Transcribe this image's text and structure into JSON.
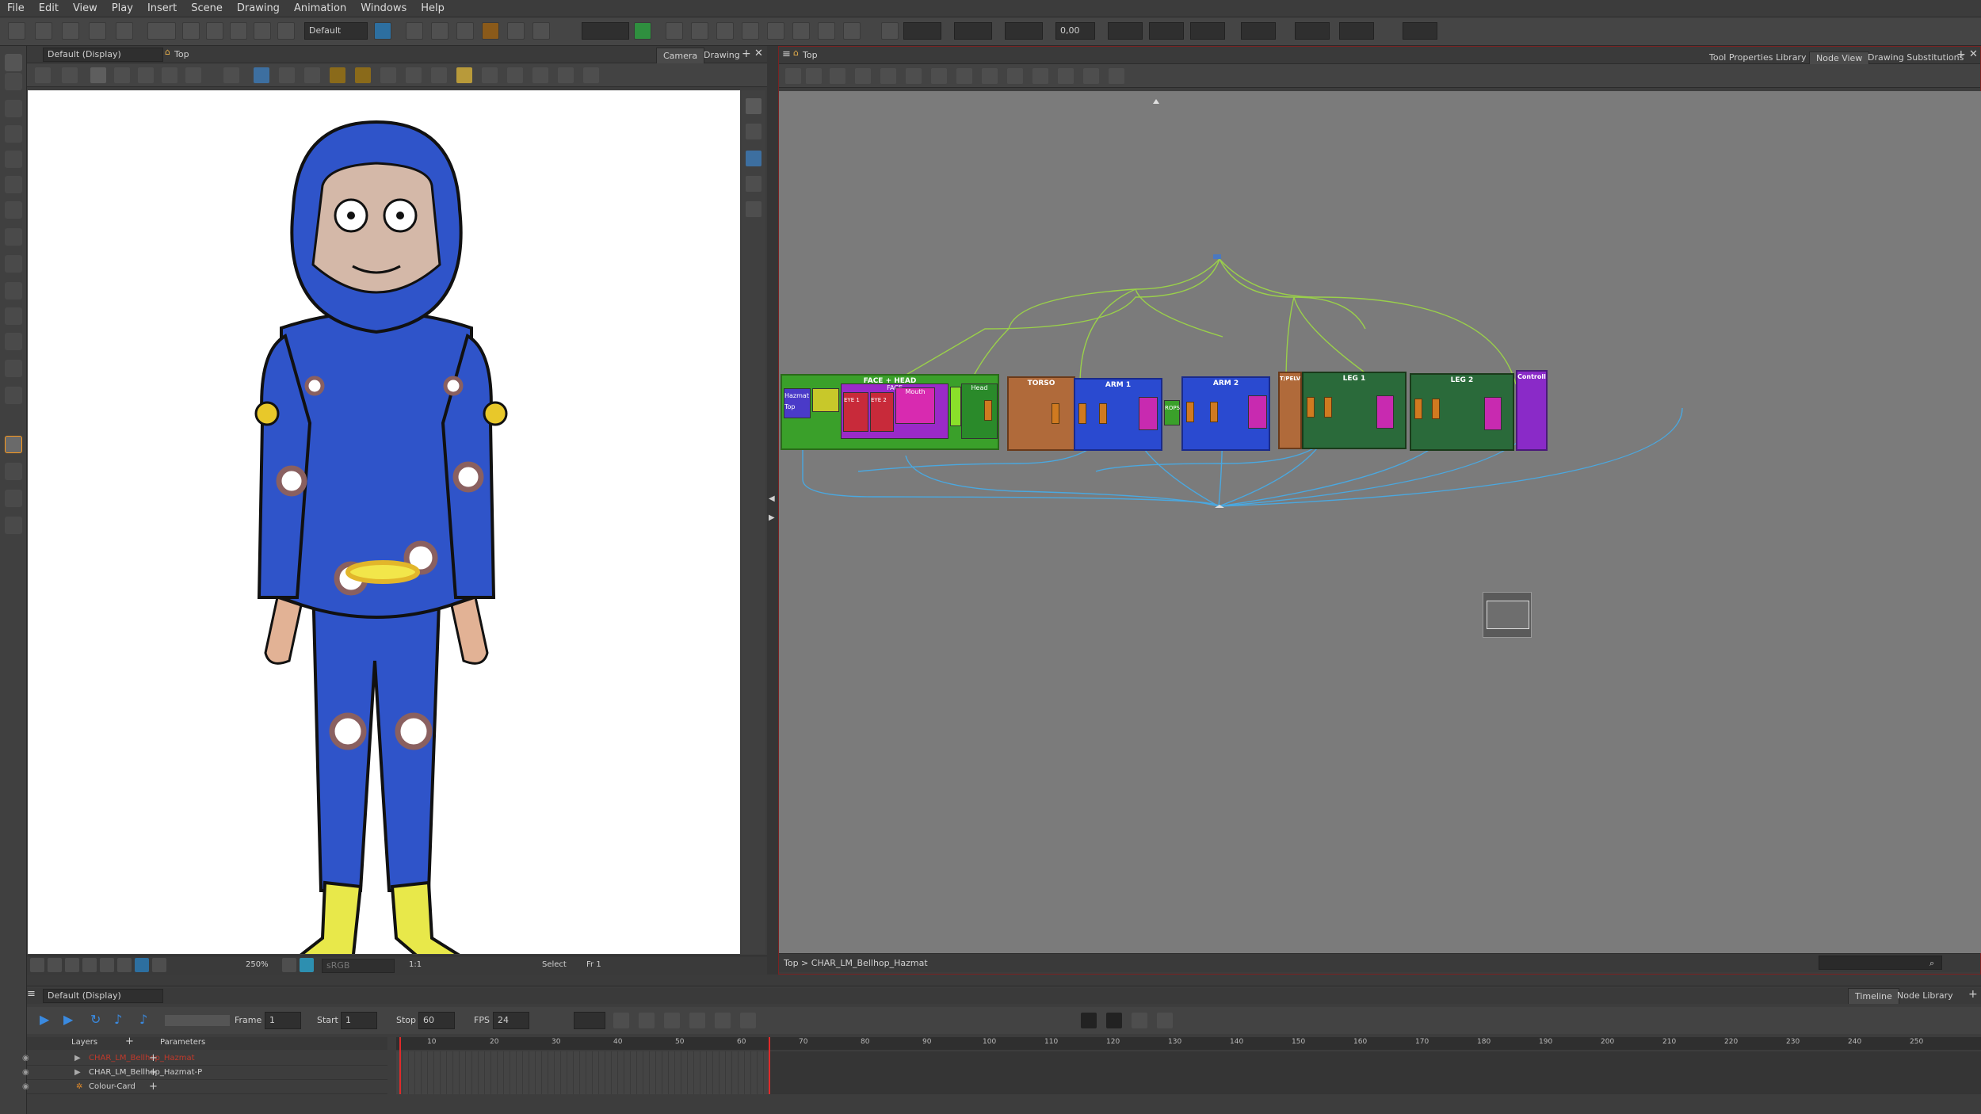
{
  "menu": [
    "File",
    "Edit",
    "View",
    "Play",
    "Insert",
    "Scene",
    "Drawing",
    "Animation",
    "Windows",
    "Help"
  ],
  "toolbar": {
    "workspace": "Default",
    "zoom_value": "0,00"
  },
  "camera": {
    "view_mode": "Default (Display)",
    "breadcrumb": "Top",
    "tabs": [
      "Camera",
      "Drawing"
    ],
    "zoom": "250%",
    "colorspace": "sRGB",
    "ratio": "1:1",
    "status_tool": "Select",
    "status_frame": "Fr 1"
  },
  "node": {
    "breadcrumb": "Top",
    "tabs": [
      "Tool Properties",
      "Library",
      "Node View",
      "Drawing Substitutions"
    ],
    "path": "Top  >  CHAR_LM_Bellhop_Hazmat",
    "groups": [
      {
        "label": "FACE + HEAD"
      },
      {
        "label": "TORSO"
      },
      {
        "label": "ARM 1"
      },
      {
        "label": "ARM 2"
      },
      {
        "label": "T/PELV"
      },
      {
        "label": "LEG 1"
      },
      {
        "label": "LEG 2"
      },
      {
        "label": "Controll"
      }
    ],
    "subs": [
      {
        "label": "Hazmat Top"
      },
      {
        "label": "FACE"
      },
      {
        "label": "EYE 1"
      },
      {
        "label": "EYE 2"
      },
      {
        "label": "Mouth"
      },
      {
        "label": "Head"
      },
      {
        "label": "ROPS"
      }
    ]
  },
  "timeline": {
    "view_mode": "Default (Display)",
    "tabs": [
      "Timeline",
      "Node Library"
    ],
    "frame_label": "Frame",
    "frame": "1",
    "start_label": "Start",
    "start": "1",
    "stop_label": "Stop",
    "stop": "60",
    "fps_label": "FPS",
    "fps": "24",
    "layers_header": "Layers",
    "params_header": "Parameters",
    "layers": [
      {
        "name": "CHAR_LM_Bellhop_Hazmat",
        "color": "#c0392b"
      },
      {
        "name": "CHAR_LM_Bellhop_Hazmat-P",
        "color": "#d0d0d0"
      },
      {
        "name": "Colour-Card",
        "color": "#d0d0d0"
      }
    ],
    "ticks": [
      "10",
      "20",
      "30",
      "40",
      "50",
      "60",
      "70",
      "80",
      "90",
      "100",
      "110",
      "120",
      "130",
      "140",
      "150",
      "160",
      "170",
      "180",
      "190",
      "200",
      "210",
      "220",
      "230",
      "240",
      "250"
    ]
  }
}
